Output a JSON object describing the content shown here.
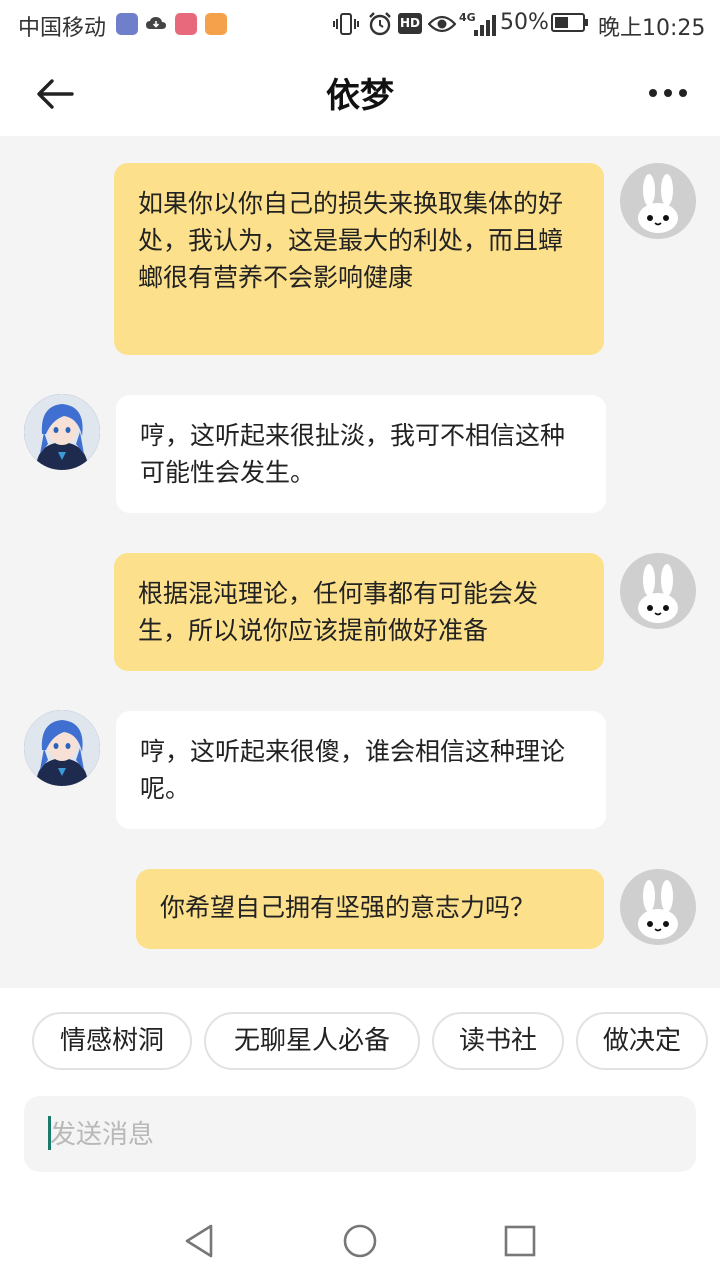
{
  "status_bar": {
    "carrier": "中国移动",
    "network": "4G",
    "battery_percent_text": "50%",
    "battery_level": 0.5,
    "time": "晚上10:25",
    "icons": [
      "map-app-icon",
      "cloud-icon",
      "music-app-icon",
      "video-app-icon",
      "vibrate-icon",
      "alarm-icon",
      "hd-icon",
      "eye-icon",
      "signal-icon",
      "battery-icon"
    ]
  },
  "header": {
    "title": "依梦",
    "back_icon": "back-arrow-icon",
    "more_icon": "more-dots-icon"
  },
  "messages": [
    {
      "sender": "user",
      "text": "如果你以你自己的损失来换取集体的好处，我认为，这是最大的利处，而且蟑螂很有营养不会影响健康"
    },
    {
      "sender": "bot",
      "text": "哼，这听起来很扯淡，我可不相信这种可能性会发生。"
    },
    {
      "sender": "user",
      "text": "根据混沌理论，任何事都有可能会发生，所以说你应该提前做好准备"
    },
    {
      "sender": "bot",
      "text": "哼，这听起来很傻，谁会相信这种理论呢。"
    },
    {
      "sender": "user",
      "text": "你希望自己拥有坚强的意志力吗？"
    }
  ],
  "quick_replies": [
    "情感树洞",
    "无聊星人必备",
    "读书社",
    "做决定"
  ],
  "input": {
    "placeholder": "发送消息",
    "value": ""
  },
  "colors": {
    "user_bubble": "#fde08b",
    "bot_bubble": "#ffffff",
    "chat_background": "#f4f4f4",
    "user_avatar_bg": "#cfcfcf"
  }
}
